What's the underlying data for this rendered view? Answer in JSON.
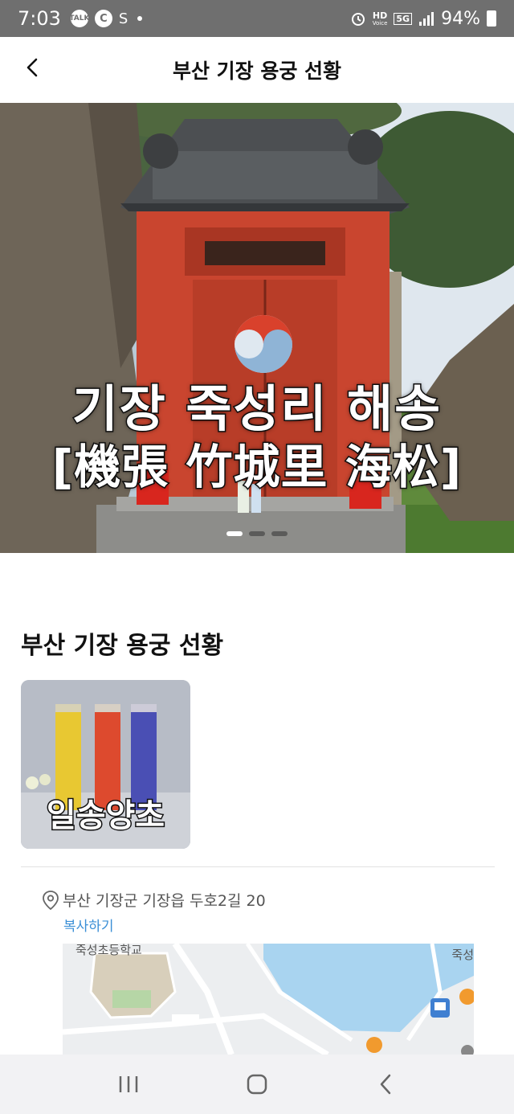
{
  "status_bar": {
    "time": "7:03",
    "icons_left": [
      "talk-icon",
      "c-icon",
      "s-icon"
    ],
    "talk_label": "TALK",
    "c_label": "C",
    "s_label": "S",
    "hd_label": "HD",
    "voice_label": "Voice",
    "network_label": "5G",
    "battery_percent": "94%"
  },
  "header": {
    "title": "부산 기장 용궁 선황"
  },
  "hero": {
    "caption_line1": "기장 죽성리 해송",
    "caption_line2": "[機張 竹城里 海松]",
    "slide_count": 3,
    "active_slide": 1
  },
  "content": {
    "section_title": "부산 기장 용궁 선황",
    "product_label": "일송양초",
    "address": "부산 기장군 기장읍 두호2길 20",
    "copy_label": "복사하기",
    "map_label_school": "죽성초등학교",
    "map_label_right": "죽성"
  },
  "colors": {
    "accent_link": "#3b8fd6",
    "status_bar": "#6f6f6f",
    "shrine_red": "#c9452f"
  }
}
